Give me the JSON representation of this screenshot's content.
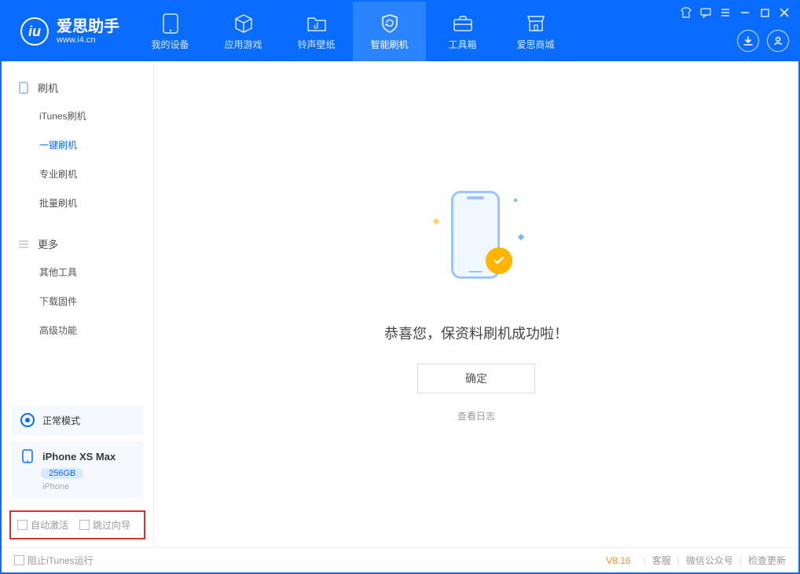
{
  "app": {
    "title": "爱思助手",
    "url": "www.i4.cn"
  },
  "tabs": {
    "device": "我的设备",
    "apps": "应用游戏",
    "ringtone": "铃声壁纸",
    "flash": "智能刷机",
    "toolbox": "工具箱",
    "store": "爱思商城"
  },
  "sidebar": {
    "section_flash": "刷机",
    "items_flash": {
      "itunes": "iTunes刷机",
      "onekey": "一键刷机",
      "pro": "专业刷机",
      "batch": "批量刷机"
    },
    "section_more": "更多",
    "items_more": {
      "other": "其他工具",
      "download": "下载固件",
      "advanced": "高级功能"
    },
    "mode": "正常模式",
    "device": {
      "name": "iPhone XS Max",
      "storage": "256GB",
      "type": "iPhone"
    },
    "checks": {
      "auto_activate": "自动激活",
      "skip_guide": "跳过向导"
    }
  },
  "main": {
    "message": "恭喜您，保资料刷机成功啦！",
    "confirm": "确定",
    "viewlog": "查看日志"
  },
  "footer": {
    "block_itunes": "阻止iTunes运行",
    "version": "V8.16",
    "support": "客服",
    "wechat": "微信公众号",
    "update": "检查更新"
  }
}
